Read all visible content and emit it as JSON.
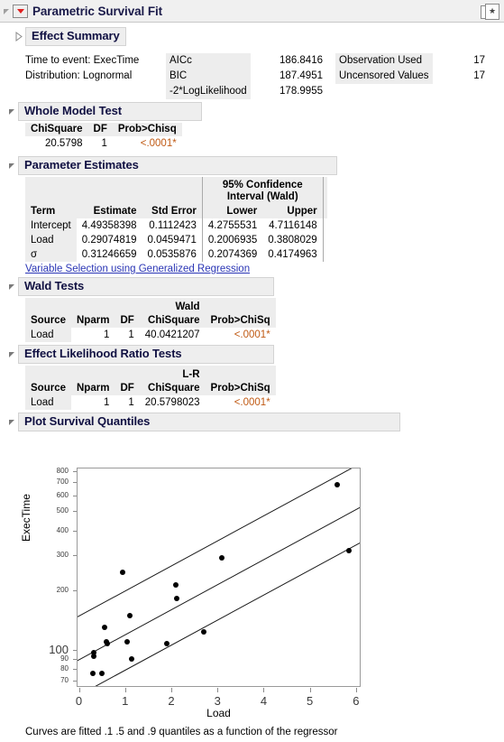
{
  "window": {
    "title": "Parametric Survival Fit",
    "disclosure_icon": "red-triangle-menu-icon",
    "corner_icon": "window-restore-icon"
  },
  "effect_summary": {
    "label": "Effect Summary",
    "collapsed": true
  },
  "summary": {
    "left": [
      "Time to event: ExecTime",
      "Distribution: Lognormal"
    ],
    "fit_stats": [
      {
        "name": "AICc",
        "value": "186.8416"
      },
      {
        "name": "BIC",
        "value": "187.4951"
      },
      {
        "name": "-2*LogLikelihood",
        "value": "178.9955"
      }
    ],
    "counts": [
      {
        "name": "Observation Used",
        "value": "17"
      },
      {
        "name": "Uncensored Values",
        "value": "17"
      }
    ]
  },
  "whole_model_test": {
    "title": "Whole Model Test",
    "columns": [
      "ChiSquare",
      "DF",
      "Prob>Chisq"
    ],
    "rows": [
      {
        "chisquare": "20.5798",
        "df": "1",
        "prob": "<.0001*"
      }
    ]
  },
  "parameter_estimates": {
    "title": "Parameter Estimates",
    "group_header": "95% Confidence",
    "group_header2": "Interval (Wald)",
    "columns": [
      "Term",
      "Estimate",
      "Std Error",
      "Lower",
      "Upper"
    ],
    "rows": [
      {
        "term": "Intercept",
        "estimate": "4.49358398",
        "std_error": "0.1112423",
        "lower": "4.2755531",
        "upper": "4.7116148"
      },
      {
        "term": "Load",
        "estimate": "0.29074819",
        "std_error": "0.0459471",
        "lower": "0.2006935",
        "upper": "0.3808029"
      },
      {
        "term": "σ",
        "estimate": "0.31246659",
        "std_error": "0.0535876",
        "lower": "0.2074369",
        "upper": "0.4174963"
      }
    ],
    "link_text": "Variable Selection using Generalized Regression"
  },
  "wald_tests": {
    "title": "Wald Tests",
    "group_header": "Wald",
    "columns": [
      "Source",
      "Nparm",
      "DF",
      "ChiSquare",
      "Prob>ChiSq"
    ],
    "rows": [
      {
        "source": "Load",
        "nparm": "1",
        "df": "1",
        "chisquare": "40.0421207",
        "prob": "<.0001*"
      }
    ]
  },
  "effect_lr_tests": {
    "title": "Effect Likelihood Ratio Tests",
    "group_header": "L-R",
    "columns": [
      "Source",
      "Nparm",
      "DF",
      "ChiSquare",
      "Prob>ChiSq"
    ],
    "rows": [
      {
        "source": "Load",
        "nparm": "1",
        "df": "1",
        "chisquare": "20.5798023",
        "prob": "<.0001*"
      }
    ]
  },
  "plot_section": {
    "title": "Plot Survival Quantiles",
    "footnote": "Curves are fitted .1 .5 and .9 quantiles as a function of the regressor"
  },
  "chart_data": {
    "type": "scatter",
    "title": "Plot Survival Quantiles",
    "xlabel": "Load",
    "ylabel": "ExecTime",
    "xlim": [
      -0.05,
      6.1
    ],
    "ylim": [
      65,
      830
    ],
    "yscale": "log",
    "xticks": [
      0,
      1,
      2,
      3,
      4,
      5,
      6
    ],
    "yticks": [
      70,
      80,
      90,
      100,
      200,
      300,
      400,
      500,
      600,
      700,
      800
    ],
    "grid": false,
    "legend": null,
    "points": [
      {
        "x": 0.3,
        "y": 76
      },
      {
        "x": 0.32,
        "y": 97
      },
      {
        "x": 0.33,
        "y": 93
      },
      {
        "x": 0.5,
        "y": 76
      },
      {
        "x": 0.55,
        "y": 130
      },
      {
        "x": 0.6,
        "y": 110
      },
      {
        "x": 0.62,
        "y": 108
      },
      {
        "x": 0.95,
        "y": 245
      },
      {
        "x": 1.05,
        "y": 110
      },
      {
        "x": 1.1,
        "y": 148
      },
      {
        "x": 1.15,
        "y": 90
      },
      {
        "x": 1.9,
        "y": 107
      },
      {
        "x": 2.1,
        "y": 212
      },
      {
        "x": 2.12,
        "y": 182
      },
      {
        "x": 2.7,
        "y": 123
      },
      {
        "x": 3.1,
        "y": 290
      },
      {
        "x": 5.6,
        "y": 680
      },
      {
        "x": 5.85,
        "y": 318
      }
    ],
    "curves": [
      {
        "name": ".9 quantile",
        "intercept_y": 148,
        "slope_per_x": 0.29074819,
        "quantile": 0.9
      },
      {
        "name": ".5 quantile",
        "intercept_y": 89,
        "slope_per_x": 0.29074819,
        "quantile": 0.5
      },
      {
        "name": ".1 quantile",
        "intercept_y": 59,
        "slope_per_x": 0.29074819,
        "quantile": 0.1
      }
    ]
  },
  "colors": {
    "title_text": "#1b1b4a",
    "pvalue": "#c05a14",
    "link": "#2a35b5",
    "header_bg": "#ededed",
    "panel_bg": "#f0f0f0"
  }
}
